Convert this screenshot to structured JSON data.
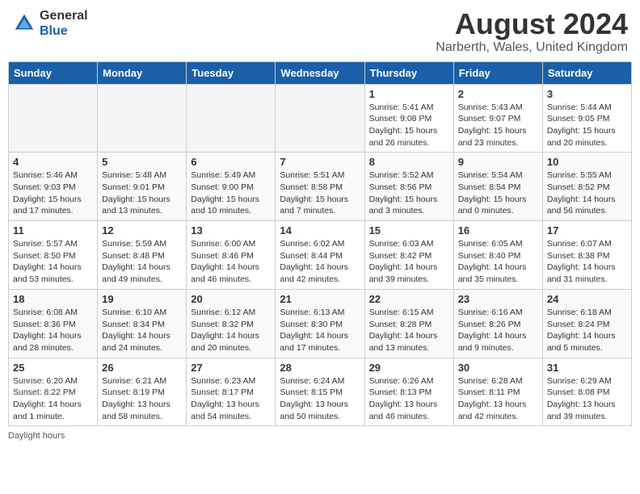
{
  "header": {
    "logo_line1": "General",
    "logo_line2": "Blue",
    "month_title": "August 2024",
    "location": "Narberth, Wales, United Kingdom"
  },
  "days_of_week": [
    "Sunday",
    "Monday",
    "Tuesday",
    "Wednesday",
    "Thursday",
    "Friday",
    "Saturday"
  ],
  "weeks": [
    [
      {
        "day": "",
        "info": ""
      },
      {
        "day": "",
        "info": ""
      },
      {
        "day": "",
        "info": ""
      },
      {
        "day": "",
        "info": ""
      },
      {
        "day": "1",
        "info": "Sunrise: 5:41 AM\nSunset: 9:08 PM\nDaylight: 15 hours\nand 26 minutes."
      },
      {
        "day": "2",
        "info": "Sunrise: 5:43 AM\nSunset: 9:07 PM\nDaylight: 15 hours\nand 23 minutes."
      },
      {
        "day": "3",
        "info": "Sunrise: 5:44 AM\nSunset: 9:05 PM\nDaylight: 15 hours\nand 20 minutes."
      }
    ],
    [
      {
        "day": "4",
        "info": "Sunrise: 5:46 AM\nSunset: 9:03 PM\nDaylight: 15 hours\nand 17 minutes."
      },
      {
        "day": "5",
        "info": "Sunrise: 5:48 AM\nSunset: 9:01 PM\nDaylight: 15 hours\nand 13 minutes."
      },
      {
        "day": "6",
        "info": "Sunrise: 5:49 AM\nSunset: 9:00 PM\nDaylight: 15 hours\nand 10 minutes."
      },
      {
        "day": "7",
        "info": "Sunrise: 5:51 AM\nSunset: 8:58 PM\nDaylight: 15 hours\nand 7 minutes."
      },
      {
        "day": "8",
        "info": "Sunrise: 5:52 AM\nSunset: 8:56 PM\nDaylight: 15 hours\nand 3 minutes."
      },
      {
        "day": "9",
        "info": "Sunrise: 5:54 AM\nSunset: 8:54 PM\nDaylight: 15 hours\nand 0 minutes."
      },
      {
        "day": "10",
        "info": "Sunrise: 5:55 AM\nSunset: 8:52 PM\nDaylight: 14 hours\nand 56 minutes."
      }
    ],
    [
      {
        "day": "11",
        "info": "Sunrise: 5:57 AM\nSunset: 8:50 PM\nDaylight: 14 hours\nand 53 minutes."
      },
      {
        "day": "12",
        "info": "Sunrise: 5:59 AM\nSunset: 8:48 PM\nDaylight: 14 hours\nand 49 minutes."
      },
      {
        "day": "13",
        "info": "Sunrise: 6:00 AM\nSunset: 8:46 PM\nDaylight: 14 hours\nand 46 minutes."
      },
      {
        "day": "14",
        "info": "Sunrise: 6:02 AM\nSunset: 8:44 PM\nDaylight: 14 hours\nand 42 minutes."
      },
      {
        "day": "15",
        "info": "Sunrise: 6:03 AM\nSunset: 8:42 PM\nDaylight: 14 hours\nand 39 minutes."
      },
      {
        "day": "16",
        "info": "Sunrise: 6:05 AM\nSunset: 8:40 PM\nDaylight: 14 hours\nand 35 minutes."
      },
      {
        "day": "17",
        "info": "Sunrise: 6:07 AM\nSunset: 8:38 PM\nDaylight: 14 hours\nand 31 minutes."
      }
    ],
    [
      {
        "day": "18",
        "info": "Sunrise: 6:08 AM\nSunset: 8:36 PM\nDaylight: 14 hours\nand 28 minutes."
      },
      {
        "day": "19",
        "info": "Sunrise: 6:10 AM\nSunset: 8:34 PM\nDaylight: 14 hours\nand 24 minutes."
      },
      {
        "day": "20",
        "info": "Sunrise: 6:12 AM\nSunset: 8:32 PM\nDaylight: 14 hours\nand 20 minutes."
      },
      {
        "day": "21",
        "info": "Sunrise: 6:13 AM\nSunset: 8:30 PM\nDaylight: 14 hours\nand 17 minutes."
      },
      {
        "day": "22",
        "info": "Sunrise: 6:15 AM\nSunset: 8:28 PM\nDaylight: 14 hours\nand 13 minutes."
      },
      {
        "day": "23",
        "info": "Sunrise: 6:16 AM\nSunset: 8:26 PM\nDaylight: 14 hours\nand 9 minutes."
      },
      {
        "day": "24",
        "info": "Sunrise: 6:18 AM\nSunset: 8:24 PM\nDaylight: 14 hours\nand 5 minutes."
      }
    ],
    [
      {
        "day": "25",
        "info": "Sunrise: 6:20 AM\nSunset: 8:22 PM\nDaylight: 14 hours\nand 1 minute."
      },
      {
        "day": "26",
        "info": "Sunrise: 6:21 AM\nSunset: 8:19 PM\nDaylight: 13 hours\nand 58 minutes."
      },
      {
        "day": "27",
        "info": "Sunrise: 6:23 AM\nSunset: 8:17 PM\nDaylight: 13 hours\nand 54 minutes."
      },
      {
        "day": "28",
        "info": "Sunrise: 6:24 AM\nSunset: 8:15 PM\nDaylight: 13 hours\nand 50 minutes."
      },
      {
        "day": "29",
        "info": "Sunrise: 6:26 AM\nSunset: 8:13 PM\nDaylight: 13 hours\nand 46 minutes."
      },
      {
        "day": "30",
        "info": "Sunrise: 6:28 AM\nSunset: 8:11 PM\nDaylight: 13 hours\nand 42 minutes."
      },
      {
        "day": "31",
        "info": "Sunrise: 6:29 AM\nSunset: 8:08 PM\nDaylight: 13 hours\nand 39 minutes."
      }
    ]
  ],
  "footer": {
    "note": "Daylight hours"
  }
}
